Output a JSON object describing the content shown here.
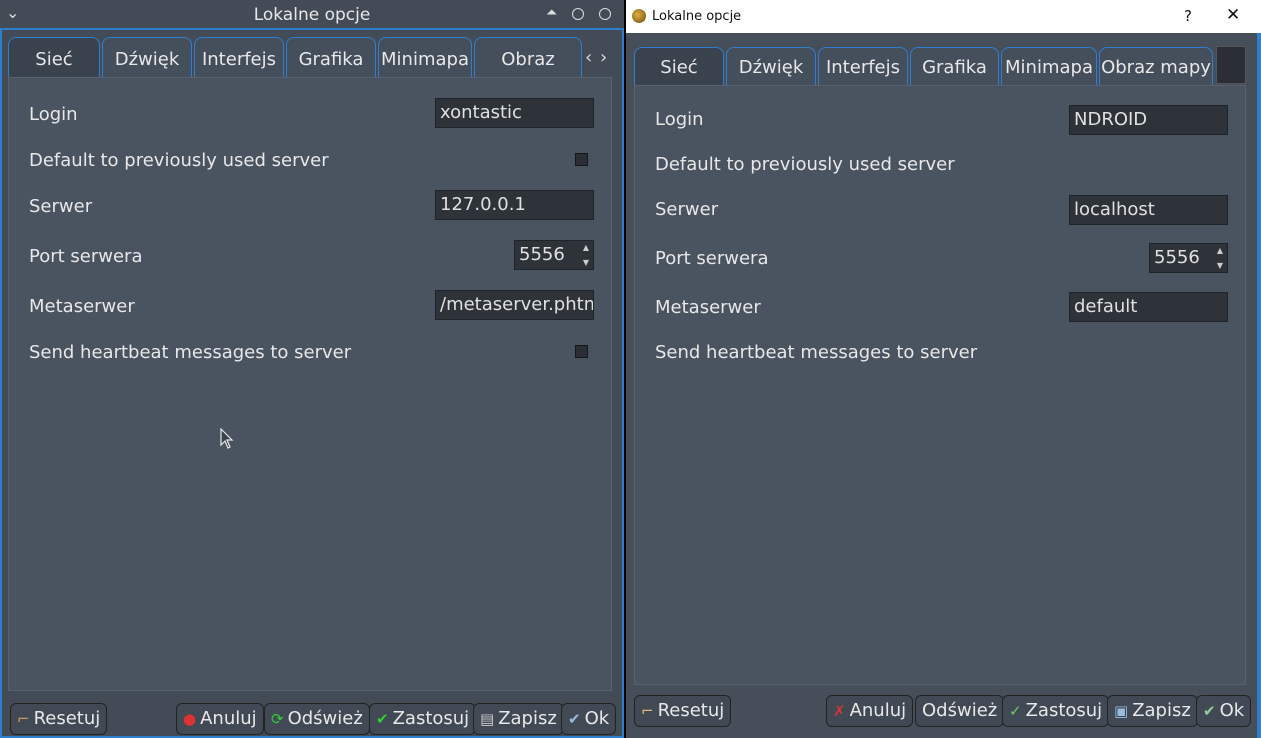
{
  "left": {
    "title": "Lokalne opcje",
    "tabs": [
      "Sieć",
      "Dźwięk",
      "Interfejs",
      "Grafika",
      "Minimapa",
      "Obraz mapy"
    ],
    "login_label": "Login",
    "login_value": "xontastic",
    "default_server_label": "Default to previously used server",
    "server_label": "Serwer",
    "server_value": "127.0.0.1",
    "port_label": "Port serwera",
    "port_value": "5556",
    "metaserver_label": "Metaserwer",
    "metaserver_value": "/metaserver.phtml",
    "heartbeat_label": "Send heartbeat messages to server",
    "buttons": {
      "reset": "Resetuj",
      "cancel": "Anuluj",
      "refresh": "Odśwież",
      "apply": "Zastosuj",
      "save": "Zapisz",
      "ok": "Ok"
    }
  },
  "right": {
    "title": "Lokalne opcje",
    "help": "?",
    "close": "✕",
    "tabs": [
      "Sieć",
      "Dźwięk",
      "Interfejs",
      "Grafika",
      "Minimapa",
      "Obraz mapy"
    ],
    "login_label": "Login",
    "login_value": "NDROID",
    "default_server_label": "Default to previously used server",
    "server_label": "Serwer",
    "server_value": "localhost",
    "port_label": "Port serwera",
    "port_value": "5556",
    "metaserver_label": "Metaserwer",
    "metaserver_value": "default",
    "heartbeat_label": "Send heartbeat messages to server",
    "buttons": {
      "reset": "Resetuj",
      "cancel": "Anuluj",
      "refresh": "Odśwież",
      "apply": "Zastosuj",
      "save": "Zapisz",
      "ok": "Ok"
    }
  },
  "colors": {
    "accent": "#2f7fd0",
    "panel": "#4a5360",
    "field": "#2e333a"
  }
}
